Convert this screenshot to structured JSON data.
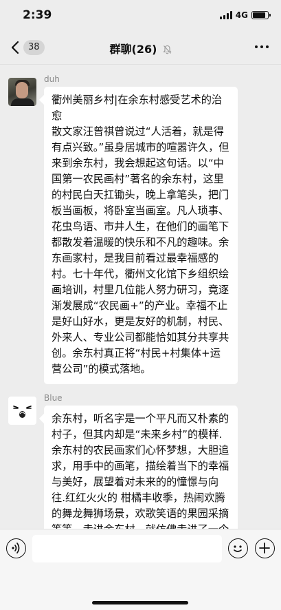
{
  "status_bar": {
    "time": "2:39",
    "network": "4G",
    "battery_level": 0.85
  },
  "nav": {
    "back_count": "38",
    "title": "群聊(26)"
  },
  "messages": [
    {
      "sender": "duh",
      "avatar": "photo-avatar",
      "text": "衢州美丽乡村|在余东村感受艺术的治愈\n散文家汪曾祺曾说过“人活着，就是得有点兴致。”虽身居城市的喧嚣许久，但来到余东村，我会想起这句话。以“中国第一农民画村”著名的余东村，这里的村民白天扛锄头，晚上拿笔头，把门板当画板，将卧室当画室。凡人琐事、花虫鸟语、市井人生，在他们的画笔下都散发着温暖的快乐和不凡的趣味。余东画家村，是我目前看过最幸福感的村。七十年代，衢州文化馆下乡组织绘画培训，村里几位能人努力研习，竟逐渐发展成“农民画+”的产业。幸福不止是好山好水，更是友好的机制，村民、外来人、专业公司都能恰如其分共享共创。余东村真正将“村民+村集体+运营公司”的模式落地。"
    },
    {
      "sender": "Blue",
      "avatar": "cartoon-avatar",
      "text": "余东村，听名字是一个平凡而又朴素的村子，但其内却是“未来乡村”的模样.余东村的农民画家们心怀梦想，大胆追求，用手中的画笔，描绘着当下的幸福与美好，展望着对未来的的憧憬与向往.红红火火的 柑橘丰收季，热闹欢腾的舞龙舞狮场景，欢歌笑语的果园采摘等等，走进余东村，就仿佛走进了一个多彩鲜活的乡村画廊，一间间被"
    }
  ],
  "input": {
    "value": "",
    "placeholder": ""
  },
  "icons": {
    "back": "chevron-left-icon",
    "mute": "bell-slash-icon",
    "more": "more-dots-icon",
    "voice": "voice-icon",
    "emoji": "emoji-icon",
    "plus": "plus-icon"
  }
}
